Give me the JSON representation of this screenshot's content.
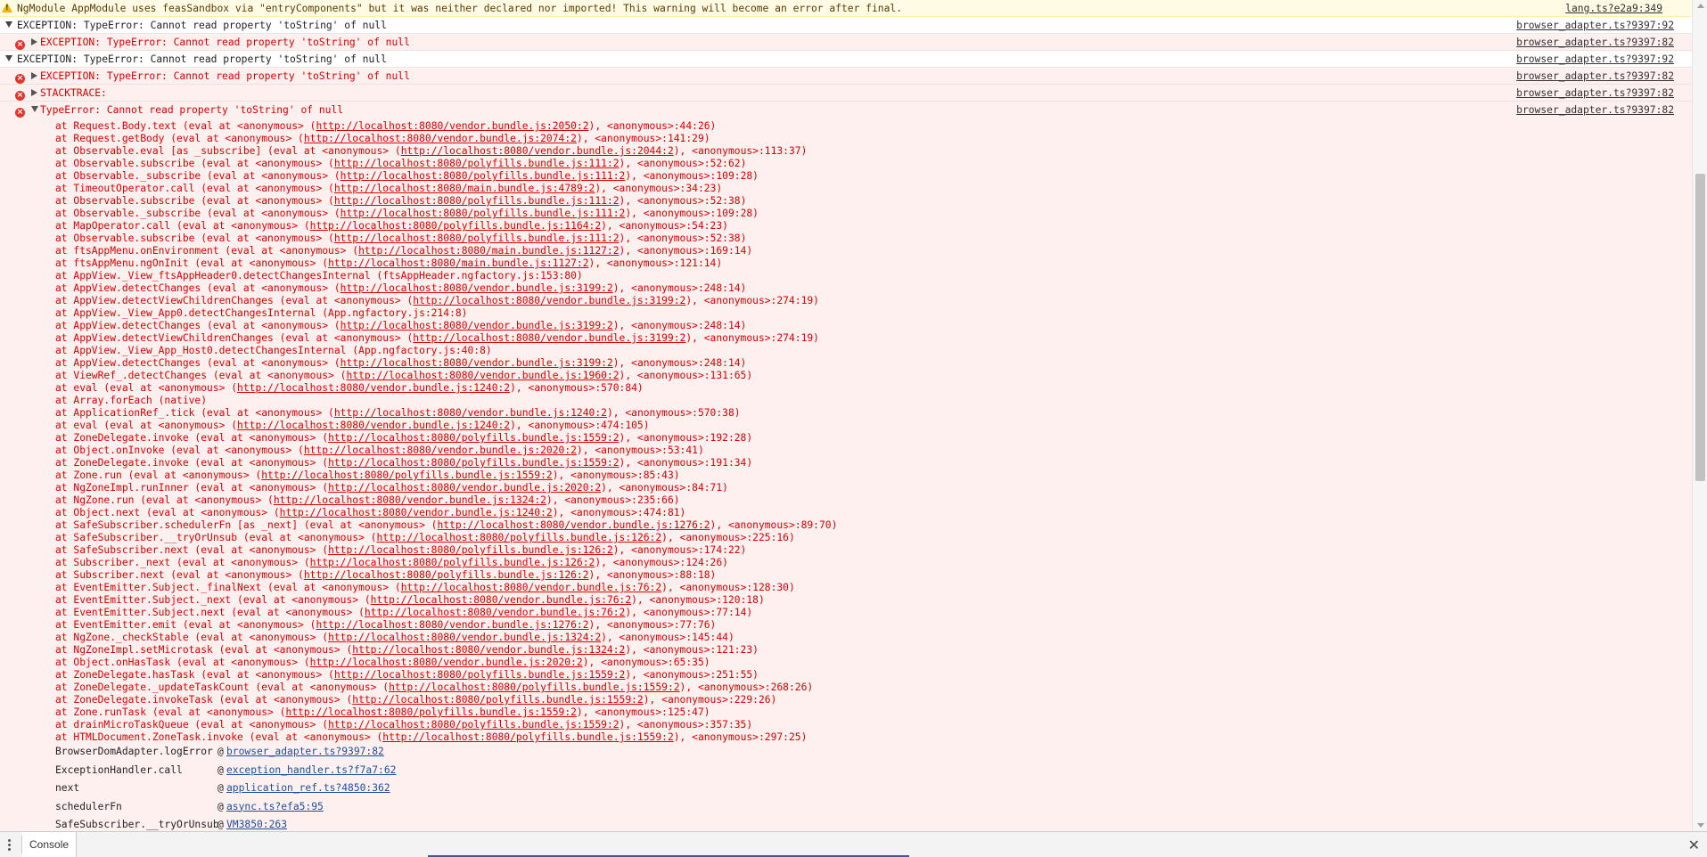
{
  "messages": [
    {
      "type": "warn",
      "expanded": false,
      "text": "NgModule AppModule uses feasSandbox via \"entryComponents\" but it was neither declared nor imported! This warning will become an error after final.",
      "source": "lang.ts?e2a9:349"
    },
    {
      "type": "group",
      "expanded": true,
      "text": "EXCEPTION: TypeError: Cannot read property 'toString' of null",
      "source": "browser_adapter.ts?9397:92"
    },
    {
      "type": "error",
      "expanded": false,
      "text": "EXCEPTION: TypeError: Cannot read property 'toString' of null",
      "source": "browser_adapter.ts?9397:82"
    },
    {
      "type": "group",
      "expanded": true,
      "text": "EXCEPTION: TypeError: Cannot read property 'toString' of null",
      "source": "browser_adapter.ts?9397:92"
    },
    {
      "type": "error",
      "expanded": false,
      "text": "EXCEPTION: TypeError: Cannot read property 'toString' of null",
      "source": "browser_adapter.ts?9397:82"
    },
    {
      "type": "error",
      "expanded": false,
      "text": "STACKTRACE:",
      "source": "browser_adapter.ts?9397:82"
    },
    {
      "type": "error",
      "expanded": true,
      "text": "TypeError: Cannot read property 'toString' of null",
      "source": "browser_adapter.ts?9397:82"
    }
  ],
  "stack": [
    {
      "pre": "at Request.Body.text (eval at <anonymous> (",
      "url": "http://localhost:8080/vendor.bundle.js:2050:2",
      "post": "), <anonymous>:44:26)"
    },
    {
      "pre": "at Request.getBody (eval at <anonymous> (",
      "url": "http://localhost:8080/vendor.bundle.js:2074:2",
      "post": "), <anonymous>:141:29)"
    },
    {
      "pre": "at Observable.eval [as _subscribe] (eval at <anonymous> (",
      "url": "http://localhost:8080/vendor.bundle.js:2044:2",
      "post": "), <anonymous>:113:37)"
    },
    {
      "pre": "at Observable.subscribe (eval at <anonymous> (",
      "url": "http://localhost:8080/polyfills.bundle.js:111:2",
      "post": "), <anonymous>:52:62)"
    },
    {
      "pre": "at Observable._subscribe (eval at <anonymous> (",
      "url": "http://localhost:8080/polyfills.bundle.js:111:2",
      "post": "), <anonymous>:109:28)"
    },
    {
      "pre": "at TimeoutOperator.call (eval at <anonymous> (",
      "url": "http://localhost:8080/main.bundle.js:4789:2",
      "post": "), <anonymous>:34:23)"
    },
    {
      "pre": "at Observable.subscribe (eval at <anonymous> (",
      "url": "http://localhost:8080/polyfills.bundle.js:111:2",
      "post": "), <anonymous>:52:38)"
    },
    {
      "pre": "at Observable._subscribe (eval at <anonymous> (",
      "url": "http://localhost:8080/polyfills.bundle.js:111:2",
      "post": "), <anonymous>:109:28)"
    },
    {
      "pre": "at MapOperator.call (eval at <anonymous> (",
      "url": "http://localhost:8080/polyfills.bundle.js:1164:2",
      "post": "), <anonymous>:54:23)"
    },
    {
      "pre": "at Observable.subscribe (eval at <anonymous> (",
      "url": "http://localhost:8080/polyfills.bundle.js:111:2",
      "post": "), <anonymous>:52:38)"
    },
    {
      "pre": "at ftsAppMenu.onEnvironment (eval at <anonymous> (",
      "url": "http://localhost:8080/main.bundle.js:1127:2",
      "post": "), <anonymous>:169:14)"
    },
    {
      "pre": "at ftsAppMenu.ngOnInit (eval at <anonymous> (",
      "url": "http://localhost:8080/main.bundle.js:1127:2",
      "post": "), <anonymous>:121:14)"
    },
    {
      "pre": "at AppView._View_ftsAppHeader0.detectChangesInternal (ftsAppHeader.ngfactory.js:153:80)",
      "url": "",
      "post": ""
    },
    {
      "pre": "at AppView.detectChanges (eval at <anonymous> (",
      "url": "http://localhost:8080/vendor.bundle.js:3199:2",
      "post": "), <anonymous>:248:14)"
    },
    {
      "pre": "at AppView.detectViewChildrenChanges (eval at <anonymous> (",
      "url": "http://localhost:8080/vendor.bundle.js:3199:2",
      "post": "), <anonymous>:274:19)"
    },
    {
      "pre": "at AppView._View_App0.detectChangesInternal (App.ngfactory.js:214:8)",
      "url": "",
      "post": ""
    },
    {
      "pre": "at AppView.detectChanges (eval at <anonymous> (",
      "url": "http://localhost:8080/vendor.bundle.js:3199:2",
      "post": "), <anonymous>:248:14)"
    },
    {
      "pre": "at AppView.detectViewChildrenChanges (eval at <anonymous> (",
      "url": "http://localhost:8080/vendor.bundle.js:3199:2",
      "post": "), <anonymous>:274:19)"
    },
    {
      "pre": "at AppView._View_App_Host0.detectChangesInternal (App.ngfactory.js:40:8)",
      "url": "",
      "post": ""
    },
    {
      "pre": "at AppView.detectChanges (eval at <anonymous> (",
      "url": "http://localhost:8080/vendor.bundle.js:3199:2",
      "post": "), <anonymous>:248:14)"
    },
    {
      "pre": "at ViewRef_.detectChanges (eval at <anonymous> (",
      "url": "http://localhost:8080/vendor.bundle.js:1960:2",
      "post": "), <anonymous>:131:65)"
    },
    {
      "pre": "at eval (eval at <anonymous> (",
      "url": "http://localhost:8080/vendor.bundle.js:1240:2",
      "post": "), <anonymous>:570:84)"
    },
    {
      "pre": "at Array.forEach (native)",
      "url": "",
      "post": ""
    },
    {
      "pre": "at ApplicationRef_.tick (eval at <anonymous> (",
      "url": "http://localhost:8080/vendor.bundle.js:1240:2",
      "post": "), <anonymous>:570:38)"
    },
    {
      "pre": "at eval (eval at <anonymous> (",
      "url": "http://localhost:8080/vendor.bundle.js:1240:2",
      "post": "), <anonymous>:474:105)"
    },
    {
      "pre": "at ZoneDelegate.invoke (eval at <anonymous> (",
      "url": "http://localhost:8080/polyfills.bundle.js:1559:2",
      "post": "), <anonymous>:192:28)"
    },
    {
      "pre": "at Object.onInvoke (eval at <anonymous> (",
      "url": "http://localhost:8080/vendor.bundle.js:2020:2",
      "post": "), <anonymous>:53:41)"
    },
    {
      "pre": "at ZoneDelegate.invoke (eval at <anonymous> (",
      "url": "http://localhost:8080/polyfills.bundle.js:1559:2",
      "post": "), <anonymous>:191:34)"
    },
    {
      "pre": "at Zone.run (eval at <anonymous> (",
      "url": "http://localhost:8080/polyfills.bundle.js:1559:2",
      "post": "), <anonymous>:85:43)"
    },
    {
      "pre": "at NgZoneImpl.runInner (eval at <anonymous> (",
      "url": "http://localhost:8080/vendor.bundle.js:2020:2",
      "post": "), <anonymous>:84:71)"
    },
    {
      "pre": "at NgZone.run (eval at <anonymous> (",
      "url": "http://localhost:8080/vendor.bundle.js:1324:2",
      "post": "), <anonymous>:235:66)"
    },
    {
      "pre": "at Object.next (eval at <anonymous> (",
      "url": "http://localhost:8080/vendor.bundle.js:1240:2",
      "post": "), <anonymous>:474:81)"
    },
    {
      "pre": "at SafeSubscriber.schedulerFn [as _next] (eval at <anonymous> (",
      "url": "http://localhost:8080/vendor.bundle.js:1276:2",
      "post": "), <anonymous>:89:70)"
    },
    {
      "pre": "at SafeSubscriber.__tryOrUnsub (eval at <anonymous> (",
      "url": "http://localhost:8080/polyfills.bundle.js:126:2",
      "post": "), <anonymous>:225:16)"
    },
    {
      "pre": "at SafeSubscriber.next (eval at <anonymous> (",
      "url": "http://localhost:8080/polyfills.bundle.js:126:2",
      "post": "), <anonymous>:174:22)"
    },
    {
      "pre": "at Subscriber._next (eval at <anonymous> (",
      "url": "http://localhost:8080/polyfills.bundle.js:126:2",
      "post": "), <anonymous>:124:26)"
    },
    {
      "pre": "at Subscriber.next (eval at <anonymous> (",
      "url": "http://localhost:8080/polyfills.bundle.js:126:2",
      "post": "), <anonymous>:88:18)"
    },
    {
      "pre": "at EventEmitter.Subject._finalNext (eval at <anonymous> (",
      "url": "http://localhost:8080/vendor.bundle.js:76:2",
      "post": "), <anonymous>:128:30)"
    },
    {
      "pre": "at EventEmitter.Subject._next (eval at <anonymous> (",
      "url": "http://localhost:8080/vendor.bundle.js:76:2",
      "post": "), <anonymous>:120:18)"
    },
    {
      "pre": "at EventEmitter.Subject.next (eval at <anonymous> (",
      "url": "http://localhost:8080/vendor.bundle.js:76:2",
      "post": "), <anonymous>:77:14)"
    },
    {
      "pre": "at EventEmitter.emit (eval at <anonymous> (",
      "url": "http://localhost:8080/vendor.bundle.js:1276:2",
      "post": "), <anonymous>:77:76)"
    },
    {
      "pre": "at NgZone._checkStable (eval at <anonymous> (",
      "url": "http://localhost:8080/vendor.bundle.js:1324:2",
      "post": "), <anonymous>:145:44)"
    },
    {
      "pre": "at NgZoneImpl.setMicrotask (eval at <anonymous> (",
      "url": "http://localhost:8080/vendor.bundle.js:1324:2",
      "post": "), <anonymous>:121:23)"
    },
    {
      "pre": "at Object.onHasTask (eval at <anonymous> (",
      "url": "http://localhost:8080/vendor.bundle.js:2020:2",
      "post": "), <anonymous>:65:35)"
    },
    {
      "pre": "at ZoneDelegate.hasTask (eval at <anonymous> (",
      "url": "http://localhost:8080/polyfills.bundle.js:1559:2",
      "post": "), <anonymous>:251:55)"
    },
    {
      "pre": "at ZoneDelegate._updateTaskCount (eval at <anonymous> (",
      "url": "http://localhost:8080/polyfills.bundle.js:1559:2",
      "post": "), <anonymous>:268:26)"
    },
    {
      "pre": "at ZoneDelegate.invokeTask (eval at <anonymous> (",
      "url": "http://localhost:8080/polyfills.bundle.js:1559:2",
      "post": "), <anonymous>:229:26)"
    },
    {
      "pre": "at Zone.runTask (eval at <anonymous> (",
      "url": "http://localhost:8080/polyfills.bundle.js:1559:2",
      "post": "), <anonymous>:125:47)"
    },
    {
      "pre": "at drainMicroTaskQueue (eval at <anonymous> (",
      "url": "http://localhost:8080/polyfills.bundle.js:1559:2",
      "post": "), <anonymous>:357:35)"
    },
    {
      "pre": "at HTMLDocument.ZoneTask.invoke (eval at <anonymous> (",
      "url": "http://localhost:8080/polyfills.bundle.js:1559:2",
      "post": "), <anonymous>:297:25)"
    }
  ],
  "frames": [
    {
      "fn": "BrowserDomAdapter.logError",
      "at": "@",
      "link": "browser_adapter.ts?9397:82"
    },
    {
      "fn": "ExceptionHandler.call",
      "at": "@",
      "link": "exception_handler.ts?f7a7:62"
    },
    {
      "fn": "next",
      "at": "@",
      "link": "application_ref.ts?4850:362"
    },
    {
      "fn": "schedulerFn",
      "at": "@",
      "link": "async.ts?efa5:95"
    },
    {
      "fn": "SafeSubscriber.__tryOrUnsub",
      "at": "@",
      "link": "VM3850:263"
    }
  ],
  "drawer": {
    "tab_label": "Console",
    "menu_icon": "kebab-menu-icon",
    "close_glyph": "✕"
  },
  "icons": {
    "warning": "warning-triangle-icon",
    "error": "error-circle-icon",
    "error_glyph": "×",
    "expand": "disclosure-triangle-icon"
  },
  "colors": {
    "error_text": "#dd0000",
    "error_bg": "#fff0f0",
    "warn_bg": "#fffbe5",
    "link_blue": "#1a4fa0"
  }
}
